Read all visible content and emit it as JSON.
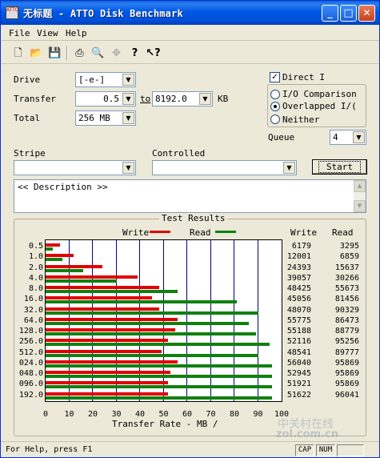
{
  "title_bar": {
    "icon_text": "ATTO",
    "title": "无标题 - ATTO Disk Benchmark",
    "minimize": "_",
    "maximize": "□",
    "close": "✕"
  },
  "menu": [
    "File",
    "View",
    "Help"
  ],
  "toolbar": {
    "icons": [
      "new-icon",
      "open-icon",
      "save-icon",
      "print-icon",
      "print-preview-icon",
      "move-icon",
      "help-icon",
      "context-help-icon"
    ]
  },
  "form": {
    "drive_label": "Drive",
    "drive_value": "[-e-]",
    "transfer_label": "Transfer",
    "transfer_from": "0.5",
    "to_label": "to",
    "transfer_to": "8192.0",
    "kb_label": "KB",
    "total_label": "Total",
    "total_value": "256 MB",
    "direct_io_label": "Direct I",
    "direct_io_checked": true,
    "io_comparison_label": "I/O Comparison",
    "overlapped_io_label": "Overlapped I/(",
    "neither_label": "Neither",
    "queue_label": "Queue",
    "queue_value": "4",
    "stripe_label": "Stripe",
    "controlled_label": "Controlled",
    "start_label": "Start",
    "description": "<< Description >>"
  },
  "results": {
    "group_title": "Test Results",
    "write_label": "Write",
    "read_label": "Read",
    "col_write": "Write",
    "col_read": "Read",
    "colors": {
      "write": "#e00000",
      "read": "#108010"
    }
  },
  "chart_data": {
    "type": "bar",
    "title": "Test Results",
    "xlabel": "Transfer Rate - MB /",
    "xlim": [
      0,
      100
    ],
    "xticks": [
      "0",
      "10",
      "20",
      "30",
      "40",
      "50",
      "60",
      "70",
      "80",
      "90",
      "100"
    ],
    "categories": [
      "0.5",
      "1.0",
      "2.0",
      "4.0",
      "8.0",
      "16.0",
      "32.0",
      "64.0",
      "128.0",
      "256.0",
      "512.0",
      "024.0",
      "048.0",
      "096.0",
      "192.0"
    ],
    "series": [
      {
        "name": "Write",
        "values": [
          6,
          12,
          24,
          39,
          48,
          45,
          48,
          56,
          55,
          52,
          49,
          56,
          53,
          52,
          52
        ]
      },
      {
        "name": "Read",
        "values": [
          3,
          7,
          16,
          30,
          56,
          81,
          90,
          86,
          89,
          95,
          90,
          96,
          96,
          96,
          96
        ]
      }
    ],
    "write_values": [
      "6179",
      "12001",
      "24393",
      "39057",
      "48425",
      "45056",
      "48070",
      "55775",
      "55188",
      "52116",
      "48541",
      "56040",
      "52945",
      "51921",
      "51622"
    ],
    "read_values": [
      "3295",
      "6859",
      "15637",
      "30266",
      "55673",
      "81456",
      "90329",
      "86473",
      "88779",
      "95256",
      "89777",
      "95869",
      "95869",
      "95869",
      "96041"
    ],
    "legend": "top"
  },
  "status": {
    "text": "For Help, press F1",
    "cap": "CAP",
    "num": "NUM"
  },
  "watermark": {
    "cn": "中关村在线",
    "site": "zol.com.cn"
  }
}
